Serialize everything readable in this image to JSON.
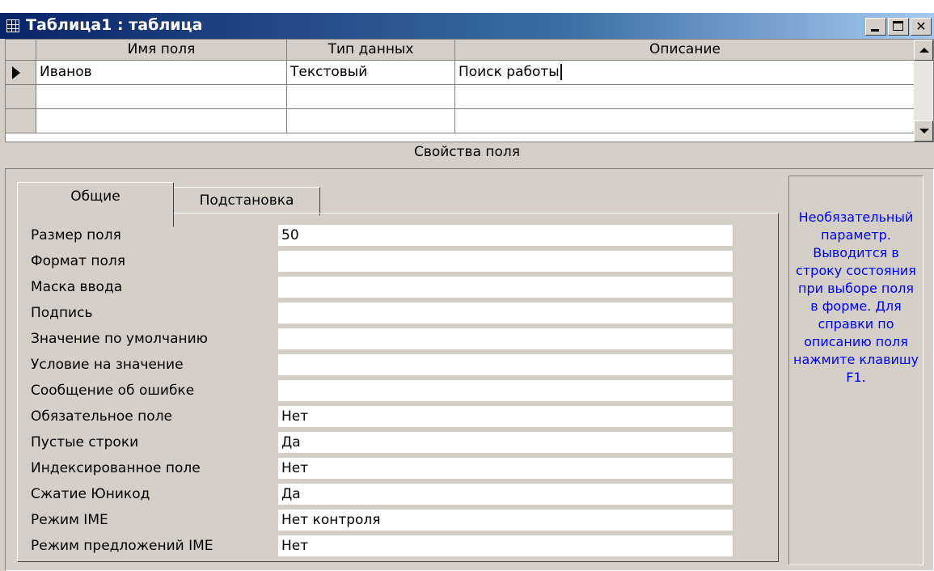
{
  "window": {
    "title": "Таблица1 : таблица"
  },
  "grid": {
    "columns": [
      "Имя поля",
      "Тип данных",
      "Описание"
    ],
    "rows": [
      {
        "field_name": "Иванов",
        "data_type": "Текстовый",
        "description": "Поиск работы"
      },
      {
        "field_name": "",
        "data_type": "",
        "description": ""
      }
    ]
  },
  "field_properties": {
    "section_title": "Свойства поля",
    "tabs": [
      "Общие",
      "Подстановка"
    ],
    "active_tab": "Общие",
    "rows": [
      {
        "label": "Размер поля",
        "value": "50"
      },
      {
        "label": "Формат поля",
        "value": ""
      },
      {
        "label": "Маска ввода",
        "value": ""
      },
      {
        "label": "Подпись",
        "value": ""
      },
      {
        "label": "Значение по умолчанию",
        "value": ""
      },
      {
        "label": "Условие на значение",
        "value": ""
      },
      {
        "label": "Сообщение об ошибке",
        "value": ""
      },
      {
        "label": "Обязательное поле",
        "value": "Нет"
      },
      {
        "label": "Пустые строки",
        "value": "Да"
      },
      {
        "label": "Индексированное поле",
        "value": "Нет"
      },
      {
        "label": "Сжатие Юникод",
        "value": "Да"
      },
      {
        "label": "Режим IME",
        "value": "Нет контроля"
      },
      {
        "label": "Режим предложений IME",
        "value": "Нет"
      }
    ],
    "help_text": "Необязательный параметр. Выводится в строку состояния при выборе поля в форме. Для справки по описанию поля нажмите клавишу F1."
  },
  "colors": {
    "title_bar": "#0a246a",
    "window_face": "#d4d0c8",
    "help_text": "#0000ff"
  }
}
